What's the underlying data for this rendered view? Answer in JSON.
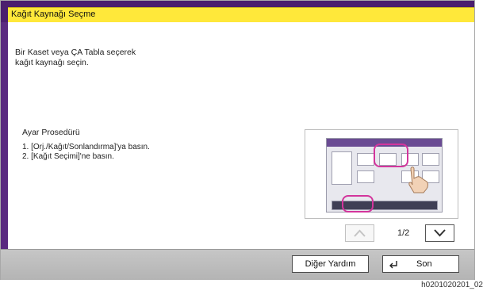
{
  "title": "Kağıt Kaynağı Seçme",
  "description": "Bir Kaset veya ÇA Tabla seçerek\nkağıt kaynağı seçin.",
  "procedure": {
    "title": "Ayar Prosedürü",
    "steps": [
      "1. [Orj./Kağıt/Sonlandırma]'ya basın.",
      "2. [Kağıt Seçimi]'ne basın."
    ]
  },
  "pager": {
    "label": "1/2",
    "up_icon": "chevron-up-icon",
    "down_icon": "chevron-down-icon"
  },
  "buttons": {
    "other_help": "Diğer Yardım",
    "end": "Son",
    "end_icon": "return-icon"
  },
  "footer_code": "h0201020201_02",
  "colors": {
    "title_bar": "#ffe83a",
    "frame": "#4b1f6e",
    "highlight": "#d3359c"
  }
}
